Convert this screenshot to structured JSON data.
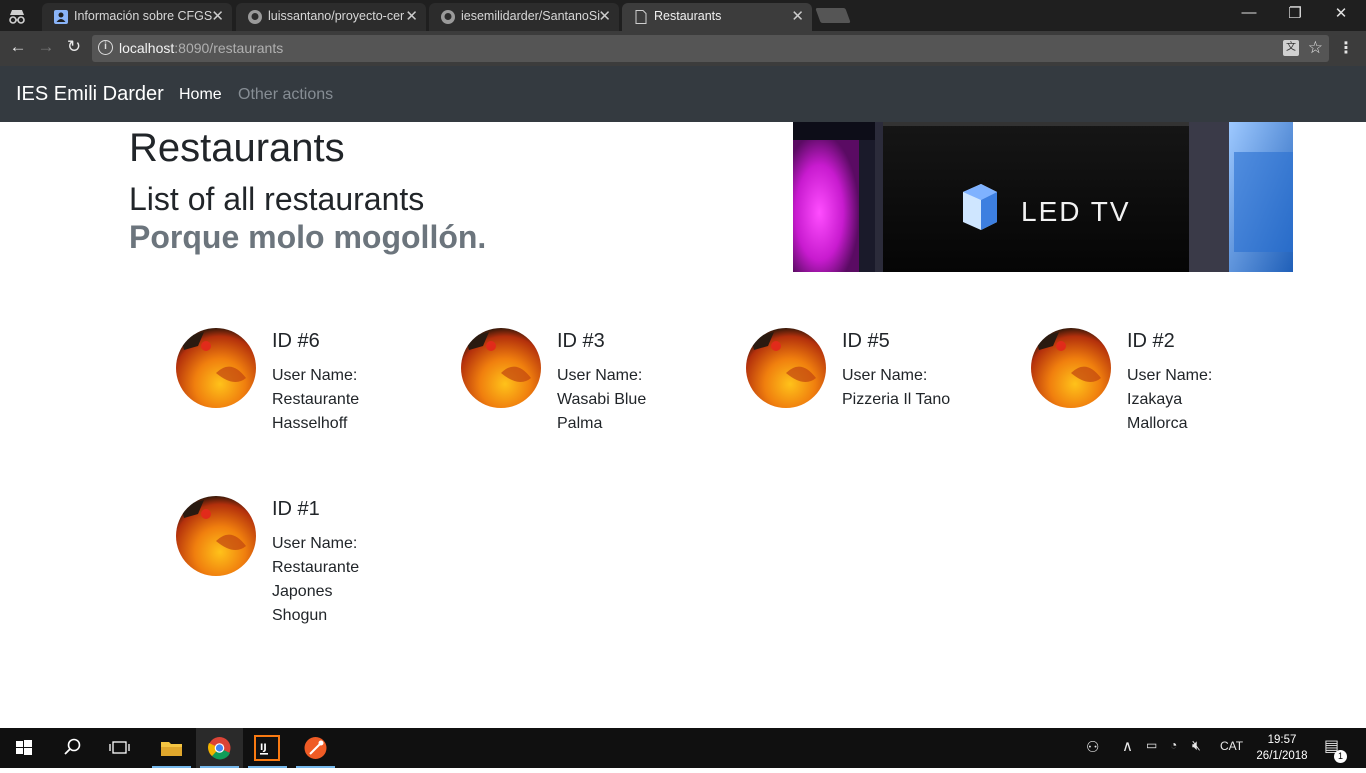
{
  "browser": {
    "tabs": [
      {
        "title": "Información sobre CFGS",
        "icon": "contact-icon"
      },
      {
        "title": "luissantano/proyecto-cer",
        "icon": "github-icon"
      },
      {
        "title": "iesemilidarder/SantanoSi",
        "icon": "github-icon"
      },
      {
        "title": "Restaurants",
        "icon": "page-icon"
      }
    ],
    "url_host": "localhost",
    "url_rest": ":8090/restaurants"
  },
  "navbar": {
    "brand": "IES Emili Darder",
    "home": "Home",
    "other": "Other actions"
  },
  "header": {
    "title": "Restaurants",
    "subtitle": "List of all restaurants",
    "tagline": "Porque molo mogollón.",
    "banner_text": "LED TV"
  },
  "restaurants": [
    {
      "id": "ID #6",
      "label": "User Name:",
      "name": "Restaurante Hasselhoff"
    },
    {
      "id": "ID #3",
      "label": "User Name:",
      "name": "Wasabi Blue Palma"
    },
    {
      "id": "ID #5",
      "label": "User Name:",
      "name": "Pizzeria Il Tano"
    },
    {
      "id": "ID #2",
      "label": "User Name:",
      "name": "Izakaya Mallorca"
    },
    {
      "id": "ID #1",
      "label": "User Name:",
      "name": "Restaurante Japones Shogun"
    }
  ],
  "taskbar": {
    "lang": "CAT",
    "time": "19:57",
    "date": "26/1/2018",
    "notifications": "1"
  }
}
